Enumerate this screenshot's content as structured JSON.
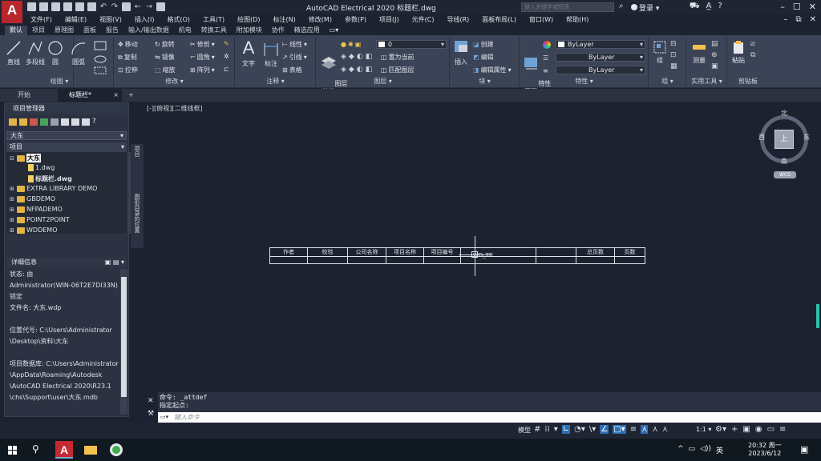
{
  "window": {
    "title": "AutoCAD Electrical 2020   标题栏.dwg",
    "search_placeholder": "键入关键字或短语",
    "login": "登录",
    "app_logo": "A"
  },
  "menu": [
    "文件(F)",
    "编辑(E)",
    "视图(V)",
    "插入(I)",
    "格式(O)",
    "工具(T)",
    "绘图(D)",
    "标注(N)",
    "修改(M)",
    "参数(P)",
    "项目(J)",
    "元件(C)",
    "导线(R)",
    "面板布局(L)",
    "窗口(W)",
    "帮助(H)"
  ],
  "ribbon_tabs": [
    "默认",
    "项目",
    "原理图",
    "面板",
    "报告",
    "输入/输出数据",
    "机电",
    "转换工具",
    "附加模块",
    "协作",
    "精选应用"
  ],
  "ribbon_tab_toggle": "▭▾",
  "ribbon": {
    "draw": {
      "title": "绘图 ▾",
      "line": "直线",
      "polyline": "多段线",
      "circle": "圆",
      "arc": "圆弧"
    },
    "modify": {
      "title": "修改 ▾",
      "move": "移动",
      "rotate": "旋转",
      "trim": "修剪",
      "copy": "复制",
      "mirror": "镜像",
      "fillet": "圆角",
      "stretch": "拉伸",
      "scale": "缩放",
      "array": "阵列"
    },
    "annotation": {
      "title": "注释 ▾",
      "text": "文字",
      "dimension": "标注",
      "linear": "线性",
      "leader": "引线",
      "table": "表格"
    },
    "layers": {
      "title": "图层 ▾",
      "layer_props": "图层\n特性",
      "current_layer": "0",
      "make_current": "置为当前",
      "match_layer": "匹配图层"
    },
    "block": {
      "title": "块 ▾",
      "insert": "插入",
      "create": "创建",
      "edit": "编辑",
      "edit_attr": "编辑属性"
    },
    "properties": {
      "title": "特性 ▾",
      "match": "特性\n匹配",
      "color": "ByLayer",
      "linetype": "ByLayer",
      "lineweight": "ByLayer"
    },
    "groups": {
      "title": "组 ▾",
      "group": "组"
    },
    "utilities": {
      "title": "实用工具 ▾",
      "measure": "测量"
    },
    "clipboard": {
      "title": "剪贴板",
      "paste": "粘贴"
    }
  },
  "doc_tabs": {
    "start": "开始",
    "active": "标题栏*",
    "close": "×",
    "new": "+"
  },
  "project_manager": {
    "title": "项目管理器",
    "current_project": "大东",
    "projects_header": "项目",
    "tree": [
      {
        "label": "大东",
        "level": 0,
        "type": "folder",
        "expander": "⊟",
        "selected": true
      },
      {
        "label": "1.dwg",
        "level": 1,
        "type": "file",
        "expander": ""
      },
      {
        "label": "标题栏.dwg",
        "level": 1,
        "type": "file",
        "expander": "",
        "bold": true
      },
      {
        "label": "EXTRA LIBRARY DEMO",
        "level": 0,
        "type": "folder",
        "expander": "⊞"
      },
      {
        "label": "GBDEMO",
        "level": 0,
        "type": "folder",
        "expander": "⊞"
      },
      {
        "label": "NFPADEMO",
        "level": 0,
        "type": "folder",
        "expander": "⊞"
      },
      {
        "label": "POINT2POINT",
        "level": 0,
        "type": "folder",
        "expander": "⊞"
      },
      {
        "label": "WDDEMO",
        "level": 0,
        "type": "folder",
        "expander": "⊞"
      }
    ],
    "details_header": "详细信息",
    "details": [
      "状态: 由",
      "Administrator(WIN-06T2E7DI33N)",
      "锁定",
      "文件名: 大东.wdp",
      "",
      "位置代号: C:\\Users\\Administrator",
      "\\Desktop\\资料\\大东",
      "",
      "项目数据库: C:\\Users\\Administrator",
      "\\AppData\\Roaming\\Autodesk",
      "\\AutoCAD Electrical 2020\\R23.1",
      "\\chs\\Support\\user\\大东.mdb"
    ],
    "side_strip_1": "项目",
    "side_strip_2": "图形目录的位置"
  },
  "canvas": {
    "view_label": "[-][俯视][二维线框]",
    "compass": {
      "north": "北",
      "south": "南",
      "east": "东",
      "west": "西",
      "face": "上",
      "wcs": "WCS"
    },
    "title_block_headers": [
      "作者",
      "校验",
      "公司名称",
      "项目名称",
      "项目编号",
      "",
      "",
      "总页数",
      "页数"
    ],
    "attr_tag": "WD_TB"
  },
  "command": {
    "history_1": "命令: _attdef",
    "history_2": "指定起点:",
    "placeholder": "键入命令"
  },
  "statusbar": {
    "model": "模型",
    "scale": "1:1 ▾"
  },
  "taskbar": {
    "ime": "英",
    "time": "20:32 周一",
    "date": "2023/6/12"
  }
}
